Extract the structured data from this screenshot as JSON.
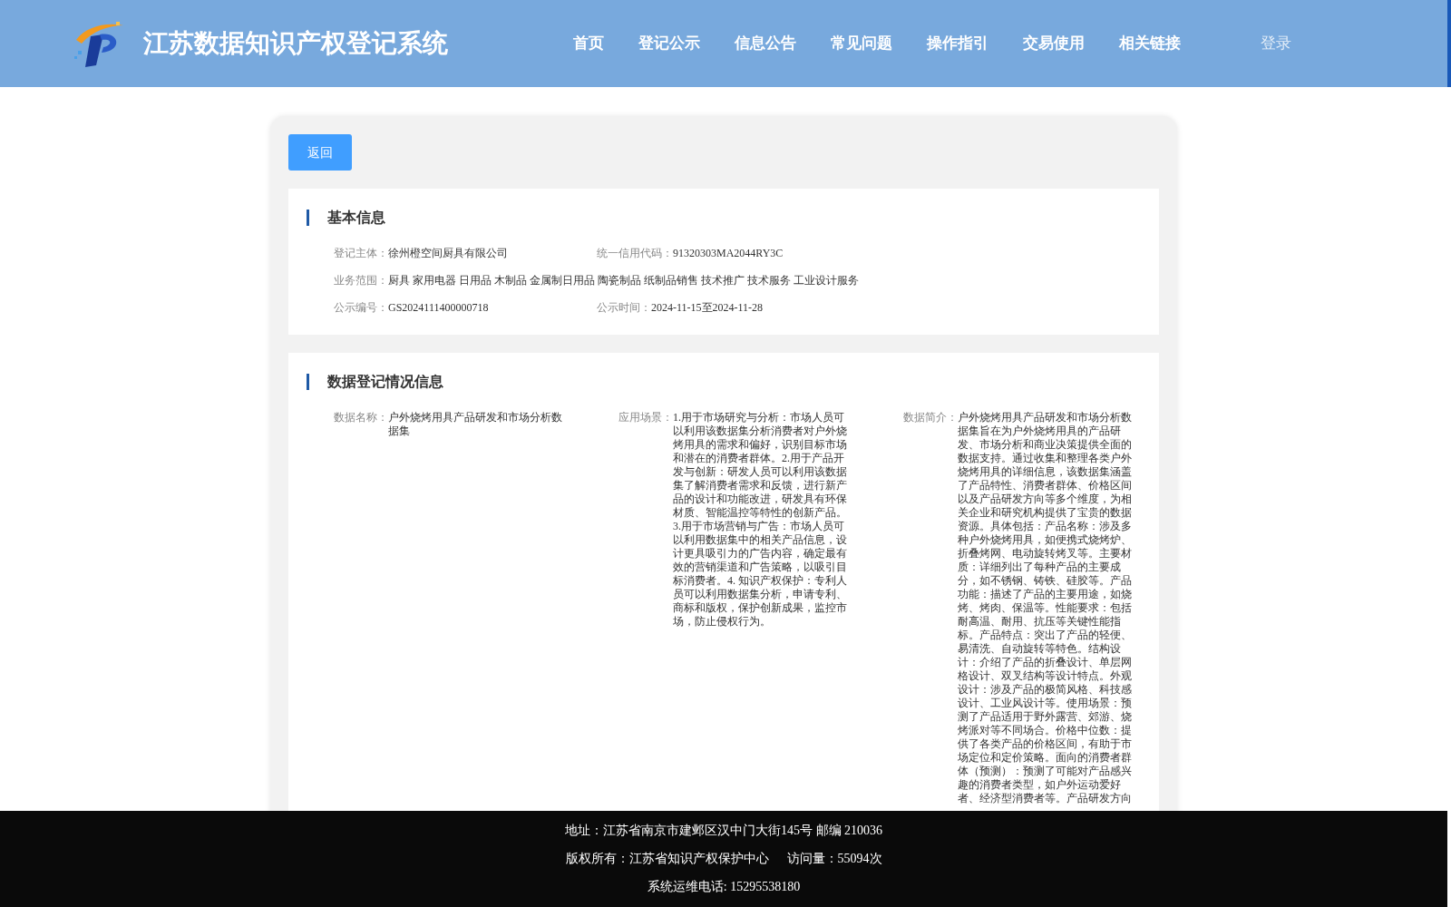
{
  "header": {
    "title": "江苏数据知识产权登记系统",
    "nav": [
      "首页",
      "登记公示",
      "信息公告",
      "常见问题",
      "操作指引",
      "交易使用",
      "相关链接"
    ],
    "login": "登录"
  },
  "back_button": "返回",
  "basic_info": {
    "title": "基本信息",
    "rows": [
      [
        {
          "label": "登记主体：",
          "value": "徐州橙空间厨具有限公司"
        },
        {
          "label": "统一信用代码：",
          "value": "91320303MA2044RY3C"
        }
      ],
      [
        {
          "label": "业务范围：",
          "value": "厨具 家用电器 日用品 木制品 金属制日用品 陶瓷制品 纸制品销售 技术推广 技术服务 工业设计服务"
        }
      ],
      [
        {
          "label": "公示编号：",
          "value": "GS2024111400000718"
        },
        {
          "label": "公示时间：",
          "value": "2024-11-15至2024-11-28"
        }
      ]
    ]
  },
  "data_info": {
    "title": "数据登记情况信息",
    "fields": [
      {
        "label": "数据名称：",
        "value": "户外烧烤用具产品研发和市场分析数据集"
      },
      {
        "label": "应用场景：",
        "value": "1.用于市场研究与分析：市场人员可以利用该数据集分析消费者对户外烧烤用具的需求和偏好，识别目标市场和潜在的消费者群体。2.用于产品开发与创新：研发人员可以利用该数据集了解消费者需求和反馈，进行新产品的设计和功能改进，研发具有环保材质、智能温控等特性的创新产品。3.用于市场营销与广告：市场人员可以利用数据集中的相关产品信息，设计更具吸引力的广告内容，确定最有效的营销渠道和广告策略，以吸引目标消费者。4. 知识产权保护：专利人员可以利用数据集分析，申请专利、商标和版权，保护创新成果，监控市场，防止侵权行为。"
      },
      {
        "label": "数据简介：",
        "value": "户外烧烤用具产品研发和市场分析数据集旨在为户外烧烤用具的产品研发、市场分析和商业决策提供全面的数据支持。通过收集和整理各类户外烧烤用具的详细信息，该数据集涵盖了产品特性、消费者群体、价格区间以及产品研发方向等多个维度，为相关企业和研究机构提供了宝贵的数据资源。具体包括：产品名称：涉及多种户外烧烤用具，如便携式烧烤炉、折叠烤网、电动旋转烤叉等。主要材质：详细列出了每种产品的主要成分，如不锈钢、铸铁、硅胶等。产品功能：描述了产品的主要用途，如烧烤、烤肉、保温等。性能要求：包括耐高温、耐用、抗压等关键性能指标。产品特点：突出了产品的轻便、易清洗、自动旋转等特色。结构设计：介绍了产品的折叠设计、单层网格设计、双叉结构等设计特点。外观设计：涉及产品的极简风格、科技感设计、工业风设计等。使用场景：预测了产品适用于野外露营、郊游、烧烤派对等不同场合。价格中位数：提供了各类产品的价格区间，有助于市场定位和定价策略。面向的消费者群体（预测）：预测了可能对产品感兴趣的消费者类型，如户外运动爱好者、经济型消费者等。产品研发方向"
      }
    ]
  },
  "footer": {
    "lines": [
      [
        "地址：江苏省南京市建邺区汉中门大街145号 邮编 210036"
      ],
      [
        "版权所有：江苏省知识产权保护中心",
        "访问量：55094次"
      ],
      [
        "系统运维电话: 15295538180"
      ]
    ]
  }
}
